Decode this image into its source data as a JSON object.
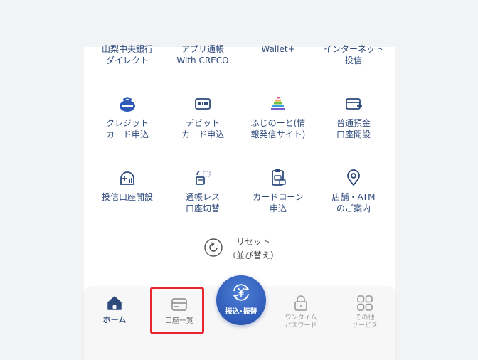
{
  "menu": {
    "row0": [
      "山梨中央銀行\nダイレクト",
      "アプリ通帳\nWith CRECO",
      "Wallet+",
      "インターネット\n投信"
    ],
    "row1": [
      "クレジット\nカード申込",
      "デビット\nカード申込",
      "ふじのーと(情\n報発信サイト)",
      "普通預金\n口座開設"
    ],
    "row2": [
      "投信口座開設",
      "通帳レス\n口座切替",
      "カードローン\n申込",
      "店舗・ATM\nのご案内"
    ]
  },
  "reset": {
    "line1": "リセット",
    "line2": "（並び替え）"
  },
  "tabbar": {
    "home": "ホーム",
    "account": "口座一覧",
    "transfer": "振込･振替",
    "otp": "ワンタイム\nパスワード",
    "services": "その他\nサービス"
  },
  "colors": {
    "primary": "#2f4b7c",
    "accent": "#2e5bb8",
    "highlight": "#e8262d"
  }
}
